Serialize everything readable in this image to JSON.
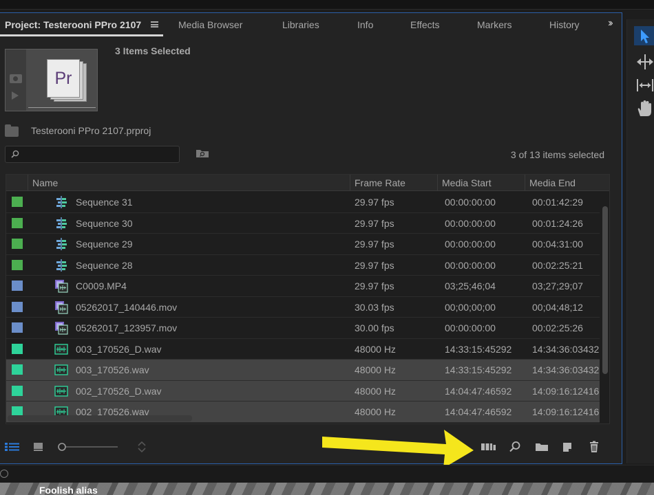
{
  "tabs": [
    {
      "label": "Project: Testerooni PPro 2107",
      "active": true
    },
    {
      "label": "Media Browser"
    },
    {
      "label": "Libraries"
    },
    {
      "label": "Info"
    },
    {
      "label": "Effects"
    },
    {
      "label": "Markers"
    },
    {
      "label": "History"
    }
  ],
  "preview": {
    "selection_title": "3 Items Selected",
    "file_badge": "Pr"
  },
  "project": {
    "filename": "Testerooni PPro 2107.prproj"
  },
  "search": {
    "value": "",
    "placeholder": ""
  },
  "selection_count": "3 of 13 items selected",
  "table": {
    "columns": [
      "Name",
      "Frame Rate",
      "Media Start",
      "Media End"
    ],
    "rows": [
      {
        "label_color": "#4caf50",
        "icon": "sequence-icon",
        "name": "Sequence 31",
        "frame_rate": "29.97 fps",
        "media_start": "00:00:00:00",
        "media_end": "00:01:42:29",
        "selected": false
      },
      {
        "label_color": "#4caf50",
        "icon": "sequence-icon",
        "name": "Sequence 30",
        "frame_rate": "29.97 fps",
        "media_start": "00:00:00:00",
        "media_end": "00:01:24:26",
        "selected": false
      },
      {
        "label_color": "#4caf50",
        "icon": "sequence-icon",
        "name": "Sequence 29",
        "frame_rate": "29.97 fps",
        "media_start": "00:00:00:00",
        "media_end": "00:04:31:00",
        "selected": false
      },
      {
        "label_color": "#4caf50",
        "icon": "sequence-icon",
        "name": "Sequence 28",
        "frame_rate": "29.97 fps",
        "media_start": "00:00:00:00",
        "media_end": "00:02:25:21",
        "selected": false
      },
      {
        "label_color": "#6b8ec9",
        "icon": "video-clip-icon",
        "name": "C0009.MP4",
        "frame_rate": "29.97 fps",
        "media_start": "03;25;46;04",
        "media_end": "03;27;29;07",
        "selected": false
      },
      {
        "label_color": "#6b8ec9",
        "icon": "video-clip-icon",
        "name": "05262017_140446.mov",
        "frame_rate": "30.03 fps",
        "media_start": "00;00;00;00",
        "media_end": "00;04;48;12",
        "selected": false
      },
      {
        "label_color": "#6b8ec9",
        "icon": "video-clip-icon",
        "name": "05262017_123957.mov",
        "frame_rate": "30.00 fps",
        "media_start": "00:00:00:00",
        "media_end": "00:02:25:26",
        "selected": false
      },
      {
        "label_color": "#2ed39a",
        "icon": "audio-clip-icon",
        "name": "003_170526_D.wav",
        "frame_rate": "48000 Hz",
        "media_start": "14:33:15:45292",
        "media_end": "14:34:36:03432",
        "selected": false
      },
      {
        "label_color": "#2ed39a",
        "icon": "audio-clip-icon",
        "name": "003_170526.wav",
        "frame_rate": "48000 Hz",
        "media_start": "14:33:15:45292",
        "media_end": "14:34:36:03432",
        "selected": true
      },
      {
        "label_color": "#2ed39a",
        "icon": "audio-clip-icon",
        "name": "002_170526_D.wav",
        "frame_rate": "48000 Hz",
        "media_start": "14:04:47:46592",
        "media_end": "14:09:16:12416",
        "selected": true
      },
      {
        "label_color": "#2ed39a",
        "icon": "audio-clip-icon",
        "name": "002_170526.wav",
        "frame_rate": "48000 Hz",
        "media_start": "14:04:47:46592",
        "media_end": "14:09:16:12416",
        "selected": true
      }
    ]
  },
  "bottom_toolbar": {
    "icons": [
      "list-view-icon",
      "icon-view-icon",
      "zoom-slider",
      "sort-icons-icon",
      "automate-to-sequence-icon",
      "find-icon",
      "new-bin-icon",
      "new-item-icon",
      "clear-icon"
    ]
  },
  "tools_panel": {
    "icons": [
      "selection-tool-icon",
      "ripple-edit-tool-icon",
      "slip-tool-icon",
      "hand-tool-icon"
    ]
  },
  "overlay_strip_text": "Foolish alias",
  "colors": {
    "accent": "#2b7bdc",
    "panel_focus_border": "#2b5fa8",
    "arrow": "#f5e61c",
    "selected_row": "#444444"
  }
}
